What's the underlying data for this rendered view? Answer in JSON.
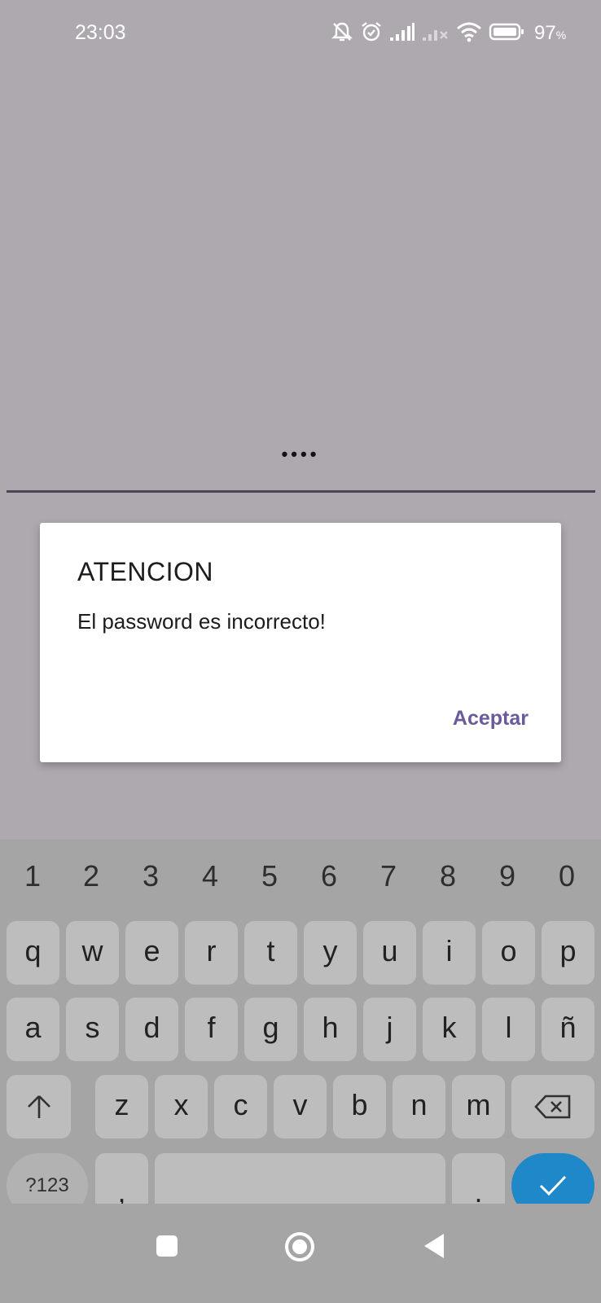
{
  "status_bar": {
    "time": "23:03",
    "battery_percent": "97",
    "battery_unit": "%",
    "icons": [
      "notifications-off-icon",
      "alarm-icon",
      "signal-icon",
      "signal-no-service-icon",
      "wifi-icon",
      "battery-icon"
    ]
  },
  "password_field": {
    "masked_value": "••••"
  },
  "dialog": {
    "title": "ATENCION",
    "message": "El password es incorrecto!",
    "action_label": "Aceptar"
  },
  "keyboard": {
    "number_row": [
      "1",
      "2",
      "3",
      "4",
      "5",
      "6",
      "7",
      "8",
      "9",
      "0"
    ],
    "row1": [
      "q",
      "w",
      "e",
      "r",
      "t",
      "y",
      "u",
      "i",
      "o",
      "p"
    ],
    "row2": [
      "a",
      "s",
      "d",
      "f",
      "g",
      "h",
      "j",
      "k",
      "l",
      "ñ"
    ],
    "row3": [
      "z",
      "x",
      "c",
      "v",
      "b",
      "n",
      "m"
    ],
    "symbols_label": "?123",
    "comma_label": ",",
    "period_label": ".",
    "enter_icon": "checkmark-icon",
    "shift_icon": "shift-arrow-icon",
    "backspace_icon": "backspace-icon"
  },
  "nav_bar": {
    "icons": [
      "recents-square-icon",
      "home-circle-icon",
      "back-triangle-icon"
    ]
  },
  "colors": {
    "scrim": "#ada9ae",
    "accent": "#6a5a9c",
    "enter_key": "#1e88c9"
  }
}
